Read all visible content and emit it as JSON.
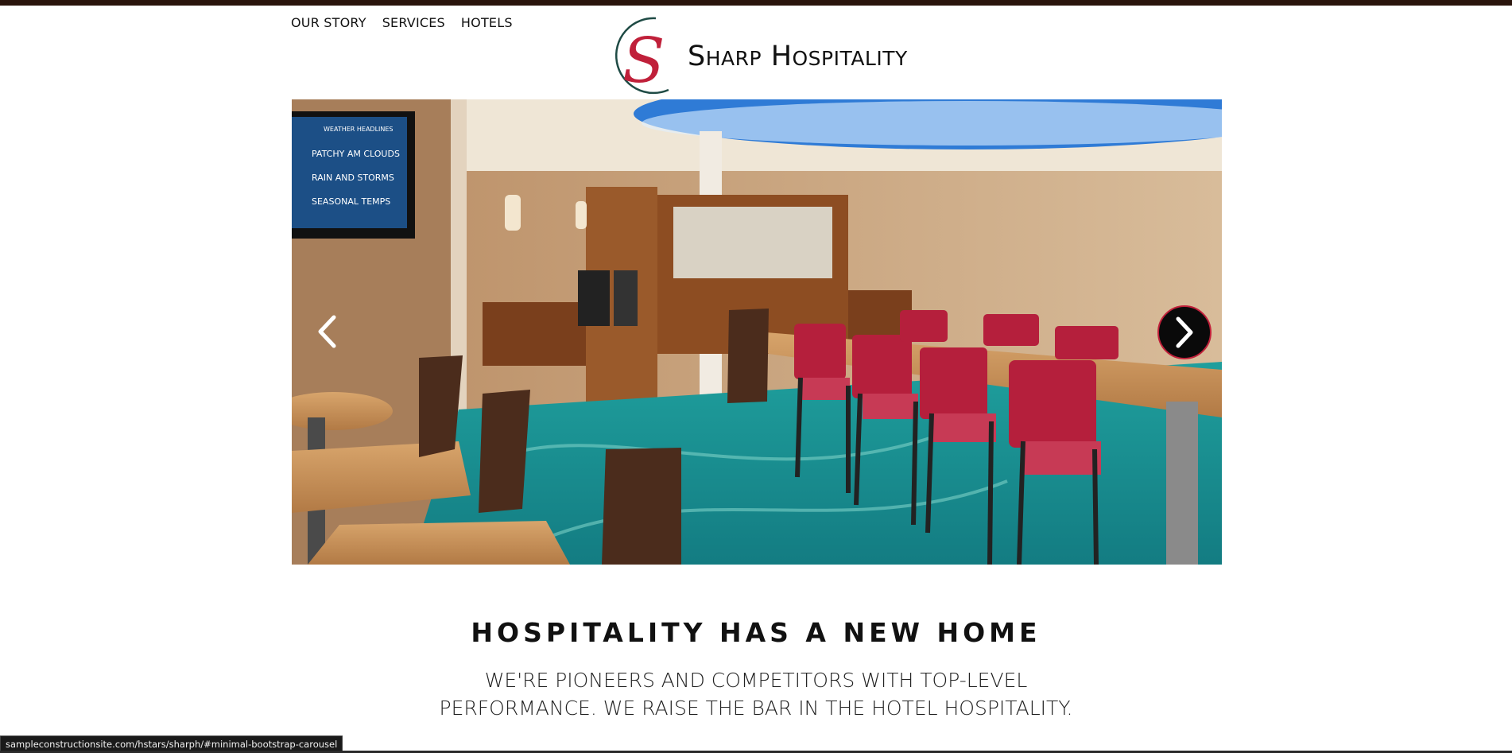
{
  "nav": {
    "items": [
      "OUR STORY",
      "SERVICES",
      "HOTELS"
    ]
  },
  "logo": {
    "text": "Sharp Hospitality",
    "letter": "S"
  },
  "carousel": {
    "prev_icon": "chevron-left-icon",
    "next_icon": "chevron-right-icon",
    "tv_lines": [
      "WEATHER HEADLINES",
      "PATCHY AM CLOUDS",
      "RAIN AND STORMS",
      "SEASONAL TEMPS"
    ]
  },
  "hero": {
    "headline": "HOSPITALITY HAS A NEW HOME",
    "tagline_line1": "WE'RE PIONEERS AND COMPETITORS WITH TOP-LEVEL",
    "tagline_line2": "PERFORMANCE. WE RAISE THE BAR IN THE HOTEL HOSPITALITY."
  },
  "status": {
    "url": "sampleconstructionsite.com/hstars/sharph/#minimal-bootstrap-carousel"
  },
  "colors": {
    "accent": "#c0203a",
    "logo_ring": "#1f4b45",
    "carpet": "#1a8f8e",
    "chair": "#b51f3c"
  }
}
